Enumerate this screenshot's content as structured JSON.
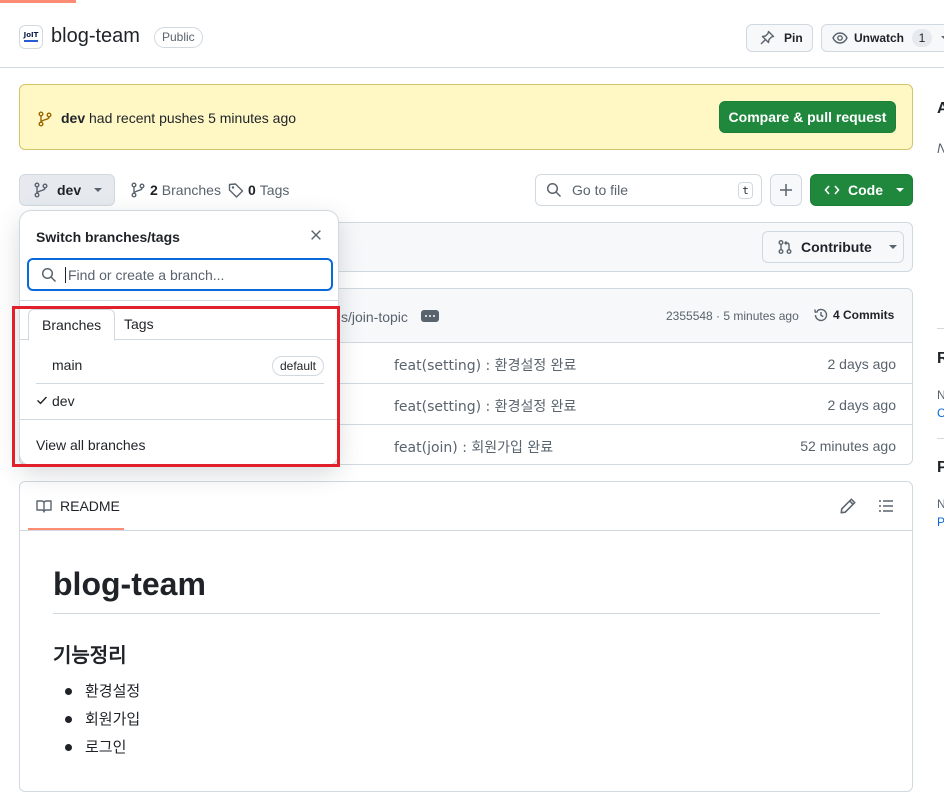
{
  "repo": {
    "name": "blog-team",
    "visibility": "Public",
    "avatar_text": "JoIT"
  },
  "header_actions": {
    "pin_label": "Pin",
    "unwatch_label": "Unwatch",
    "watch_count": "1"
  },
  "push_banner": {
    "branch": "dev",
    "text": "had recent pushes 5 minutes ago",
    "button_label": "Compare & pull request"
  },
  "branch_bar": {
    "current_branch": "dev",
    "branches_count": "2",
    "branches_label": "Branches",
    "tags_count": "0",
    "tags_label": "Tags",
    "goto_placeholder": "Go to file",
    "goto_shortcut": "t",
    "code_label": "Code"
  },
  "contribute": {
    "label": "Contribute"
  },
  "latest_commit": {
    "message_fragment": "s/join-topic",
    "hash_time": "2355548 · 5 minutes ago",
    "commits_label": "4 Commits"
  },
  "files": [
    {
      "message": "feat(setting) : 환경설정 완료",
      "age": "2 days ago"
    },
    {
      "message": "feat(setting) : 환경설정 완료",
      "age": "2 days ago"
    },
    {
      "message": "feat(join) : 회원가입 완료",
      "age": "52 minutes ago"
    }
  ],
  "readme": {
    "tab_label": "README",
    "title": "blog-team",
    "section_heading": "기능정리",
    "items": [
      "환경설정",
      "회원가입",
      "로그인"
    ]
  },
  "sidebar_fragments": [
    "A",
    "N",
    "R",
    "N",
    "C",
    "P",
    "N",
    "P"
  ],
  "branch_dropdown": {
    "title": "Switch branches/tags",
    "search_placeholder": "Find or create a branch...",
    "tabs": [
      "Branches",
      "Tags"
    ],
    "branches": [
      {
        "name": "main",
        "badge": "default",
        "selected": false
      },
      {
        "name": "dev",
        "badge": "",
        "selected": true
      }
    ],
    "footer_label": "View all branches"
  },
  "colors": {
    "primary_green": "#1f883d",
    "banner_yellow": "#fff8c5",
    "focus_blue": "#0969da",
    "highlight_red": "#e0202a",
    "accent_orange": "#fd8c73"
  }
}
